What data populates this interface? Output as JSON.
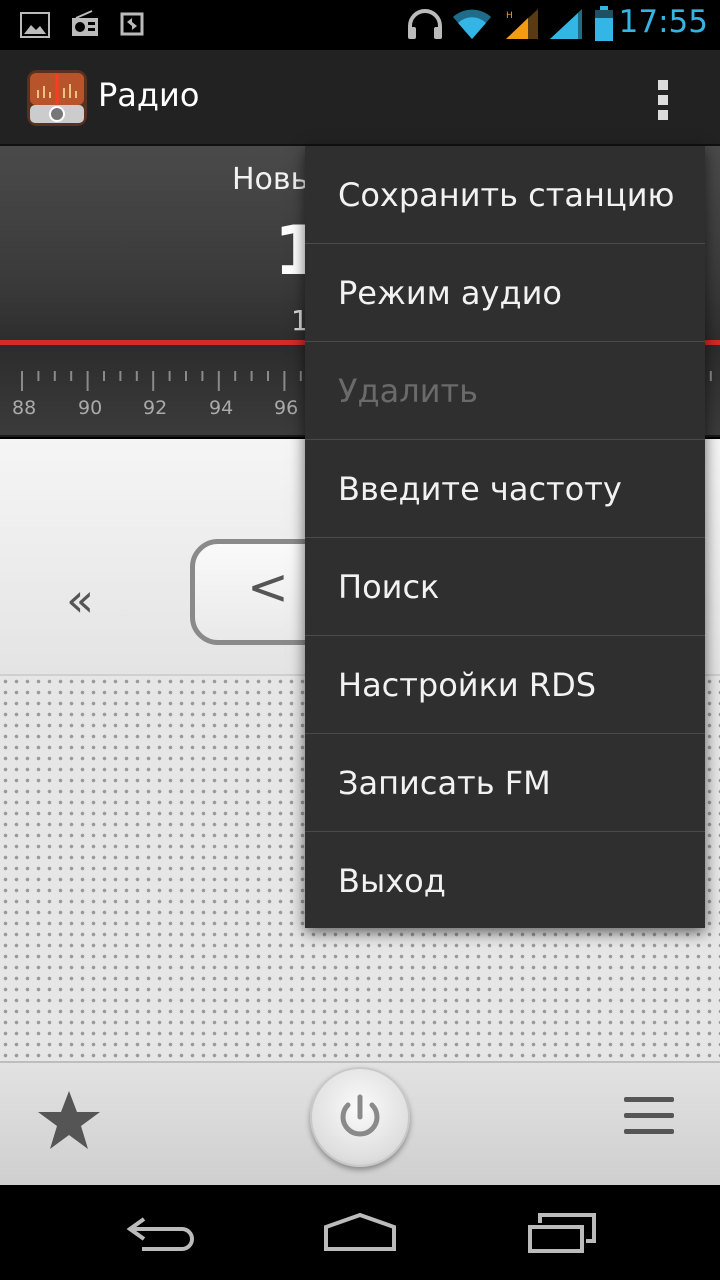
{
  "status_bar": {
    "time": "17:55",
    "accent": "#33b5e5",
    "icons": [
      "image-icon",
      "radio-icon",
      "sync-icon",
      "headphones-icon",
      "wifi-icon",
      "signal-icon",
      "signal-icon",
      "battery-icon"
    ]
  },
  "action_bar": {
    "title": "Радио",
    "app_icon": "radio-app-icon",
    "overflow_icon": "overflow-menu-icon"
  },
  "station": {
    "name": "Новы",
    "frequency": "1",
    "subtitle": "1"
  },
  "dial": {
    "labels": [
      "88",
      "90",
      "92",
      "94",
      "96"
    ],
    "accent": "#d42a2a"
  },
  "controls": {
    "seek_prev_symbol": "«",
    "step_down_symbol": "<"
  },
  "bottom_bar": {
    "favorite_icon": "star-icon",
    "power_icon": "power-icon",
    "list_icon": "list-icon"
  },
  "nav_bar": {
    "icons": [
      "back-icon",
      "home-icon",
      "recent-apps-icon"
    ]
  },
  "menu": {
    "items": [
      {
        "label": "Сохранить станцию",
        "enabled": true
      },
      {
        "label": "Режим аудио",
        "enabled": true
      },
      {
        "label": "Удалить",
        "enabled": false
      },
      {
        "label": "Введите частоту",
        "enabled": true
      },
      {
        "label": "Поиск",
        "enabled": true
      },
      {
        "label": "Настройки RDS",
        "enabled": true
      },
      {
        "label": "Записать FM",
        "enabled": true
      },
      {
        "label": "Выход",
        "enabled": true
      }
    ]
  }
}
